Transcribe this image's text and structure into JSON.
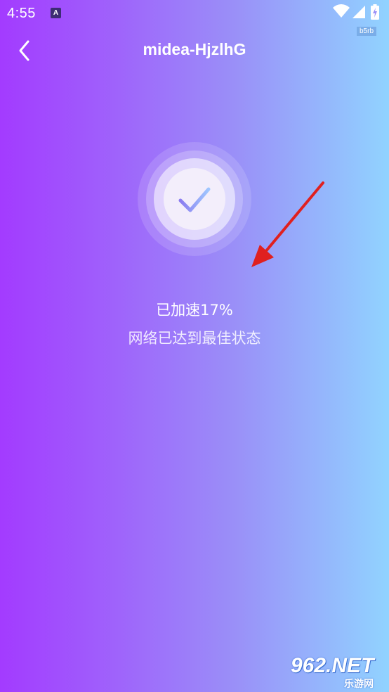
{
  "status_bar": {
    "time": "4:55",
    "notification_letter": "A"
  },
  "debug_tag": "b5rb",
  "header": {
    "title": "midea-HjzlhG"
  },
  "result": {
    "speed_label": "已加速17%",
    "status_label": "网络已达到最佳状态"
  },
  "watermark": {
    "brand": "962.NET",
    "subtitle": "乐游网"
  },
  "colors": {
    "gradient_start": "#a33bff",
    "gradient_end": "#91d3ff",
    "check_gradient_start": "#8b7cf0",
    "check_gradient_end": "#9fc7ff",
    "arrow": "#e0201f"
  }
}
